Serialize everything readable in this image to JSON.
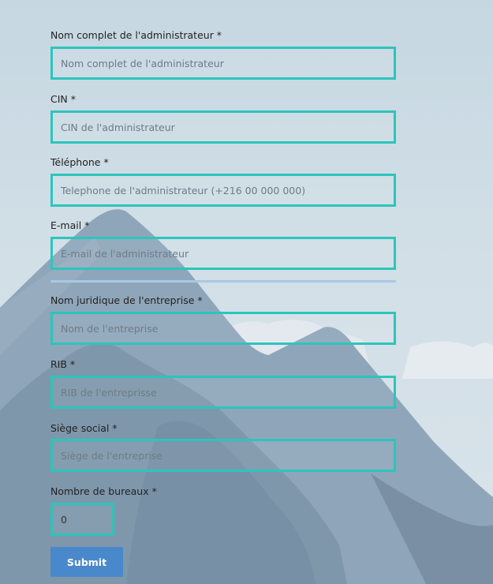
{
  "form": {
    "fields": [
      {
        "label": "Nom complet de l'administrateur *",
        "placeholder": "Nom complet de l'administrateur",
        "value": ""
      },
      {
        "label": "CIN *",
        "placeholder": "CIN de l'administrateur",
        "value": ""
      },
      {
        "label": "Téléphone *",
        "placeholder": "Telephone de l'administrateur (+216 00 000 000)",
        "value": ""
      },
      {
        "label": "E-mail *",
        "placeholder": "E-mail de l'administrateur",
        "value": ""
      },
      {
        "label": "Nom juridique de l'entreprise *",
        "placeholder": "Nom de l'entreprise",
        "value": ""
      },
      {
        "label": "RIB *",
        "placeholder": "RIB de l'entreprisse",
        "value": ""
      },
      {
        "label": "Siège social *",
        "placeholder": "Siège de l'entreprise",
        "value": ""
      },
      {
        "label": "Nombre de bureaux *",
        "placeholder": "",
        "value": "0"
      }
    ],
    "submit_label": "Submit"
  },
  "colors": {
    "field_border": "#2cc5bb",
    "submit_bg": "#4a88cc",
    "divider": "#a9c8e4"
  }
}
